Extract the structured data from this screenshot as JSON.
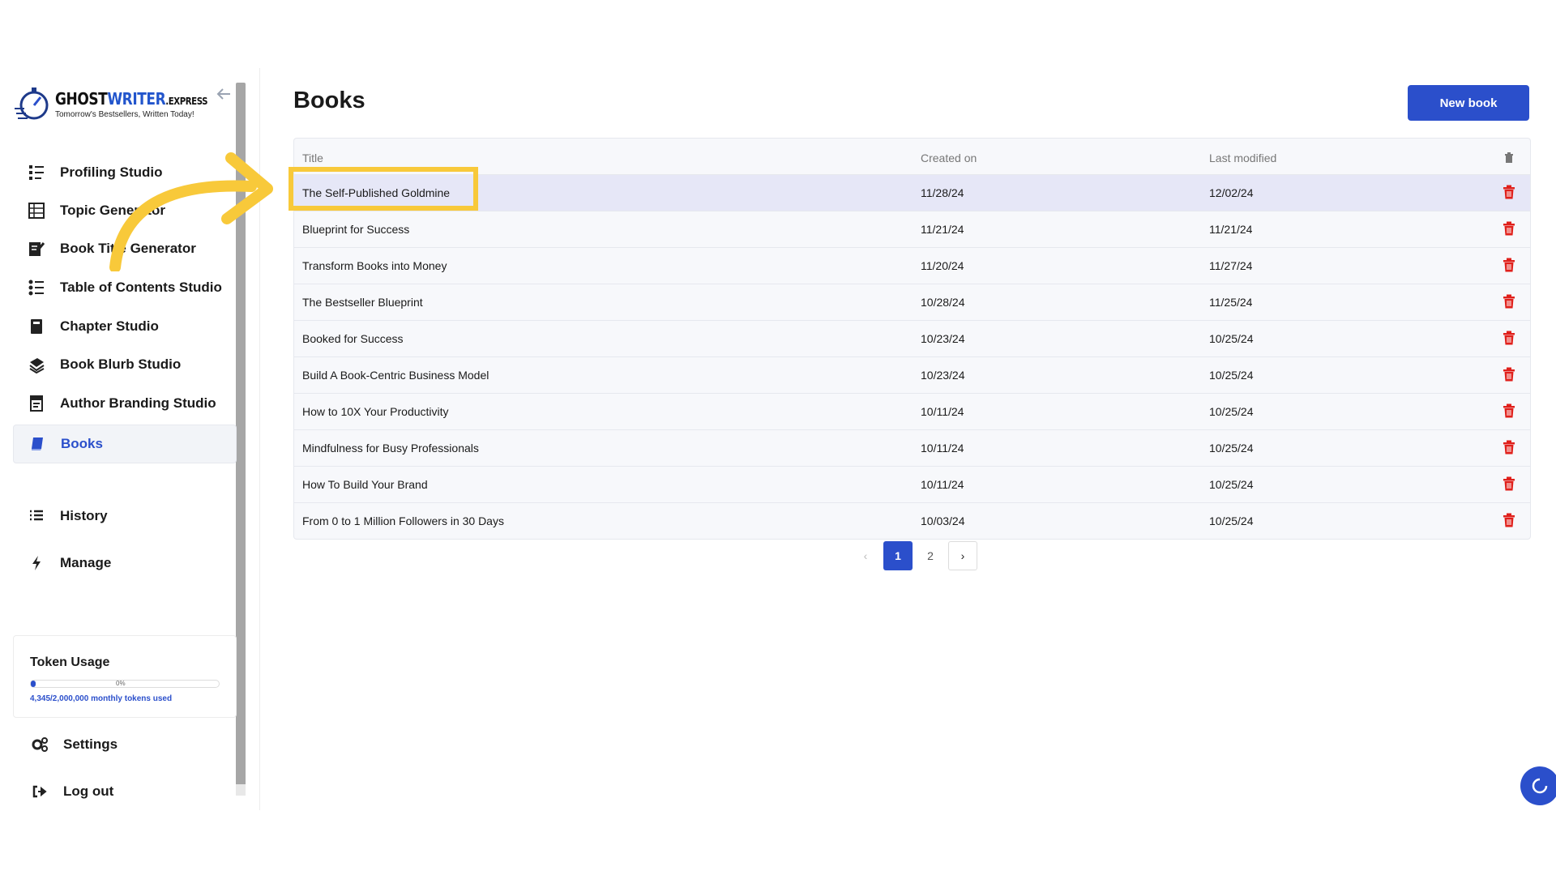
{
  "logo": {
    "brand_a": "GHOST",
    "brand_b": "WRITER",
    "brand_c": ".EXPRESS",
    "tagline": "Tomorrow's Bestsellers, Written Today!"
  },
  "sidebar": {
    "items": [
      {
        "label": "Profiling Studio",
        "icon": "profile-list-icon"
      },
      {
        "label": "Topic Generator",
        "icon": "topic-grid-icon"
      },
      {
        "label": "Book Title Generator",
        "icon": "pen-notebook-icon"
      },
      {
        "label": "Table of Contents Studio",
        "icon": "toc-list-icon"
      },
      {
        "label": "Chapter Studio",
        "icon": "chapter-book-icon"
      },
      {
        "label": "Book Blurb Studio",
        "icon": "blurb-books-icon"
      },
      {
        "label": "Author Branding Studio",
        "icon": "branding-icon"
      },
      {
        "label": "Books",
        "icon": "book-icon",
        "active": true
      },
      {
        "label": "History",
        "icon": "list-icon"
      },
      {
        "label": "Manage",
        "icon": "bolt-icon"
      }
    ],
    "settings": "Settings",
    "logout": "Log out"
  },
  "token_usage": {
    "title": "Token Usage",
    "percent_label": "0%",
    "percent": 0.002,
    "used_text": "4,345/2,000,000 monthly tokens used"
  },
  "main": {
    "title": "Books",
    "new_book": "New book",
    "columns": {
      "title": "Title",
      "created": "Created on",
      "modified": "Last modified"
    },
    "rows": [
      {
        "title": "The Self-Published Goldmine",
        "created": "11/28/24",
        "modified": "12/02/24"
      },
      {
        "title": "Blueprint for Success",
        "created": "11/21/24",
        "modified": "11/21/24"
      },
      {
        "title": "Transform Books into Money",
        "created": "11/20/24",
        "modified": "11/27/24"
      },
      {
        "title": "The Bestseller Blueprint",
        "created": "10/28/24",
        "modified": "11/25/24"
      },
      {
        "title": "Booked for Success",
        "created": "10/23/24",
        "modified": "10/25/24"
      },
      {
        "title": "Build A Book-Centric Business Model",
        "created": "10/23/24",
        "modified": "10/25/24"
      },
      {
        "title": "How to 10X Your Productivity",
        "created": "10/11/24",
        "modified": "10/25/24"
      },
      {
        "title": "Mindfulness for Busy Professionals",
        "created": "10/11/24",
        "modified": "10/25/24"
      },
      {
        "title": "How To Build Your Brand",
        "created": "10/11/24",
        "modified": "10/25/24"
      },
      {
        "title": "From 0 to 1 Million Followers in 30 Days",
        "created": "10/03/24",
        "modified": "10/25/24"
      }
    ],
    "pagination": {
      "prev": "‹",
      "pages": [
        "1",
        "2"
      ],
      "current": "1",
      "next": "›"
    }
  },
  "colors": {
    "accent": "#2b4fcb",
    "highlight": "#f8c93a",
    "delete": "#e0201b"
  }
}
